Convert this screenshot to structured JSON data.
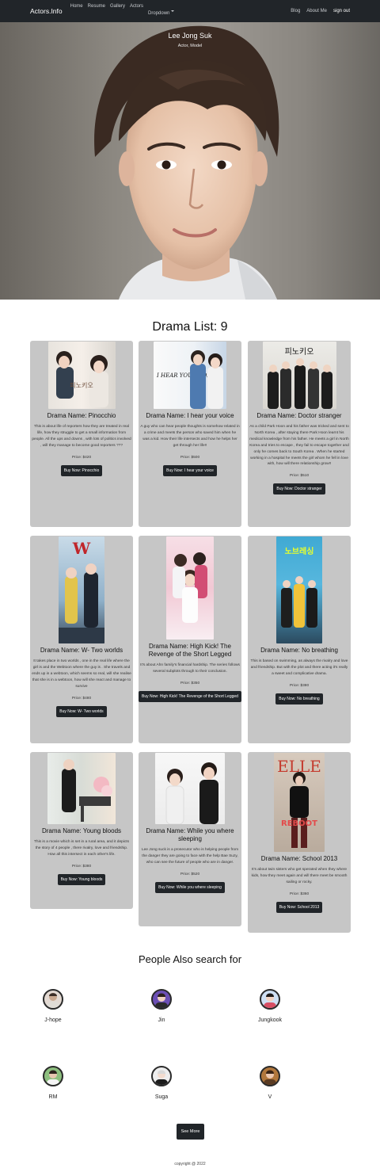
{
  "nav": {
    "brand": "Actors.Info",
    "left_links": [
      "Home",
      "Resume",
      "Gallery",
      "Actors",
      "Dropdown"
    ],
    "right_links": [
      "Blog",
      "About Me",
      "sign out"
    ]
  },
  "hero": {
    "name": "Lee Jong Suk",
    "subtitle": "Actor, Model"
  },
  "drama_list": {
    "title": "Drama List: 9",
    "items": [
      {
        "name": "Drama Name: Pinocchio",
        "desc": "This is about life of reporters how they are treated in real life, how they struggle to get a small information from people. All the ups and downs , with lots of politics involved , will they manage to become good reporters ???",
        "price": "Price: $420",
        "button": "Buy Now: Pinocchio"
      },
      {
        "name": "Drama Name: I hear your voice",
        "desc": "A guy who can hear people thoughts is somehow related in a crime and meets the person who saved him when he was a kid. How their life intersects and how he helps her get through her life!!",
        "price": "Price: $500",
        "button": "Buy Now: I hear your voice"
      },
      {
        "name": "Drama Name: Doctor stranger",
        "desc": "As a child Park Hoon and his father was tricked and sent to North Korea , after staying there Park Hoon learnt his medical knowledge from his father. He meets a girl in North Korea and tries to escape , they fail to escape together and only he comes back to South Korea . When he started working in a hospital he meets the girl whom he fell in love with, how will there relationship grow!!",
        "price": "Price: $510",
        "button": "Buy Now: Doctor stranger"
      },
      {
        "name": "Drama Name: W- Two worlds",
        "desc": "It takes place in two worlds , one in the real life where the girl is and the Webtoon where the guy is . She travels and ends up in a webtoon, which seems so real, will she realise that she is in a webtoon, how will she react and manage to survive",
        "price": "Price: $480",
        "button": "Buy Now: W- Two worlds"
      },
      {
        "name": "Drama Name: High Kick! The Revenge of the Short Legged",
        "desc": "It's about Ahn family's financial hardship. The series follows several subplots through to their conclusion.",
        "price": "Price: $350",
        "button": "Buy Now: High Kick! The Revenge of the Short Legged"
      },
      {
        "name": "Drama Name: No breathing",
        "desc": "This is based on swimming, as always the rivalry and love and friendship. But with the plot and there acting it's really a sweet and complicative drama.",
        "price": "Price: $380",
        "button": "Buy Now: No breathing"
      },
      {
        "name": "Drama Name: Young bloods",
        "desc": "This is a movie which is set in a rural area, and it depicts the story of 4 people , there rivalry, love and friendship. How all this intersect in each other's life.",
        "price": "Price: $380",
        "button": "Buy Now: Young bloods"
      },
      {
        "name": "Drama Name: While you where sleeping",
        "desc": "Lee Jong suck is a prosecutor who is helping people from the danger they are going to face with the help Bae Suzy, who can see the future of people who are in danger.",
        "price": "Price: $520",
        "button": "Buy Now: While you where sleeping"
      },
      {
        "name": "Drama Name: School 2013",
        "desc": "It's about twin sisters who get sperated when they where kids, how they meet again and will there meet be smooth sailing or rocky.",
        "price": "Price: $360",
        "button": "Buy Now: School 2013"
      }
    ]
  },
  "people": {
    "title": "People Also search for",
    "items": [
      "J-hope",
      "Jin",
      "Jungkook",
      "RM",
      "Suga",
      "V"
    ],
    "see_more": "See More"
  },
  "footer": {
    "text": "copyright @ 2022"
  },
  "colors": {
    "navbar": "#212529",
    "card_bg": "#c6c6c6",
    "button": "#212529"
  },
  "posters": [
    {
      "label": "피노키오"
    },
    {
      "label": "I HEAR YOUR VOICE"
    },
    {
      "label": "피노키오"
    },
    {
      "label": "W"
    },
    {
      "label": ""
    },
    {
      "label": "노브레싱"
    },
    {
      "label": ""
    },
    {
      "label": ""
    },
    {
      "label": "ELLE"
    }
  ]
}
